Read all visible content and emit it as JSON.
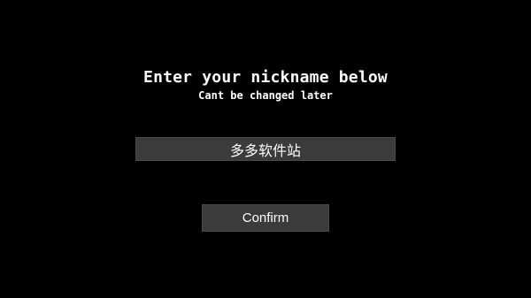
{
  "dialog": {
    "title": "Enter your nickname below",
    "subtitle": "Cant be changed later",
    "nickname_value": "多多软件站",
    "confirm_label": "Confirm"
  },
  "colors": {
    "background": "#000000",
    "panel": "#3b3b3b",
    "text": "#ffffff"
  }
}
